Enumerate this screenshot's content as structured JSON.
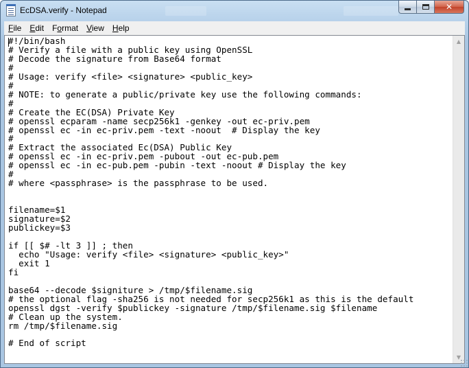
{
  "window": {
    "title": "EcDSA.verify - Notepad"
  },
  "caption": {
    "minimize_icon": "minimize-icon",
    "maximize_icon": "maximize-icon",
    "close_glyph": "✕"
  },
  "menu": {
    "items": [
      {
        "label_u": "F",
        "label_rest": "ile"
      },
      {
        "label_u": "E",
        "label_rest": "dit"
      },
      {
        "label_u": "F",
        "label_rest": "ormat",
        "prefix": "F",
        "note": "o-underline"
      },
      {
        "label_u": "V",
        "label_rest": "iew"
      },
      {
        "label_u": "H",
        "label_rest": "elp"
      }
    ]
  },
  "editor": {
    "lines": [
      "#!/bin/bash",
      "# Verify a file with a public key using OpenSSL",
      "# Decode the signature from Base64 format",
      "#",
      "# Usage: verify <file> <signature> <public_key>",
      "#",
      "# NOTE: to generate a public/private key use the following commands:",
      "#",
      "# Create the EC(DSA) Private Key",
      "# openssl ecparam -name secp256k1 -genkey -out ec-priv.pem",
      "# openssl ec -in ec-priv.pem -text -noout  # Display the key",
      "#",
      "# Extract the associated Ec(DSA) Public Key",
      "# openssl ec -in ec-priv.pem -pubout -out ec-pub.pem",
      "# openssl ec -in ec-pub.pem -pubin -text -noout # Display the key",
      "#",
      "# where <passphrase> is the passphrase to be used.",
      "",
      "",
      "filename=$1",
      "signature=$2",
      "publickey=$3",
      "",
      "if [[ $# -lt 3 ]] ; then",
      "  echo \"Usage: verify <file> <signature> <public_key>\"",
      "  exit 1",
      "fi",
      "",
      "base64 --decode $signiture > /tmp/$filename.sig",
      "# the optional flag -sha256 is not needed for secp256k1 as this is the default",
      "openssl dgst -verify $publickey -signature /tmp/$filename.sig $filename",
      "# Clean up the system.",
      "rm /tmp/$filename.sig",
      "",
      "# End of script"
    ]
  },
  "scrollbar": {
    "up_glyph": "▲",
    "down_glyph": "▼"
  }
}
